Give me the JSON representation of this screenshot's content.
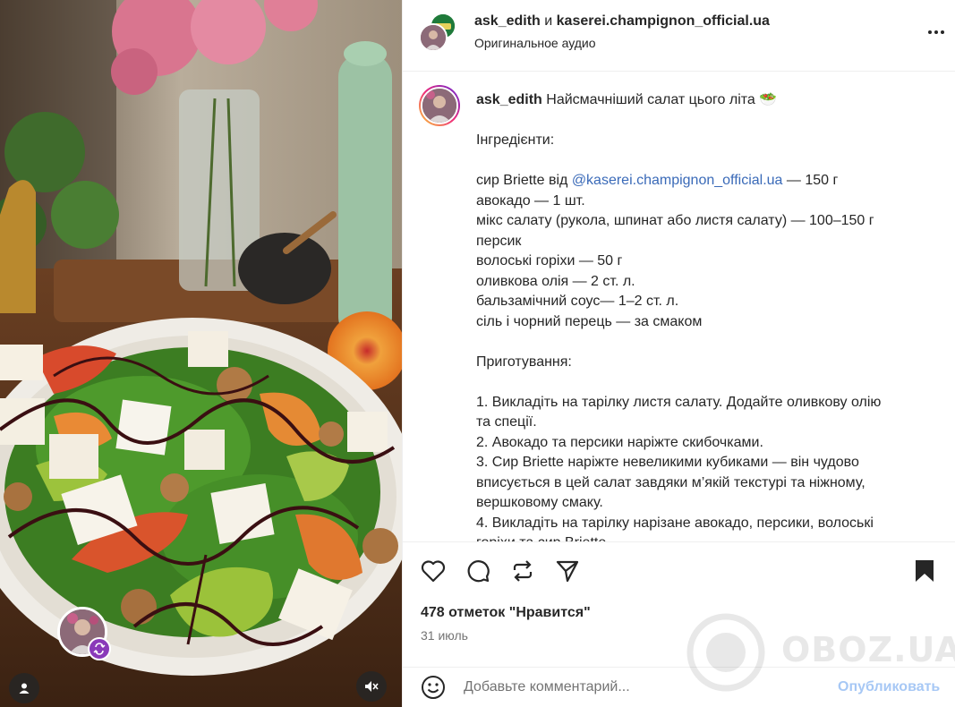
{
  "header": {
    "author": "ask_edith",
    "conjunction": "и",
    "collaborator": "kaserei.champignon_official.ua",
    "audio": "Оригинальное аудио"
  },
  "caption": {
    "username": "ask_edith",
    "title": "Найсмачніший салат цього літа 🥗",
    "lines": [
      "Інгредієнти:",
      "",
      "сир Briette від",
      "авокадо — 1 шт.",
      "мікс салату (рукола, шпинат або листя салату) — 100–150 г",
      "персик",
      "волоські горіхи — 50 г",
      "оливкова олія — 2 ст. л.",
      "бальзамічний соус— 1–2 ст. л.",
      "сіль і чорний перець — за смаком",
      "",
      "Приготування:",
      "",
      "1. Викладіть на тарілку листя салату. Додайте оливкову олію",
      "та спеції.",
      "2. Авокадо та персики наріжте скибочками.",
      "3. Сир Briette наріжте невеликими кубиками — він чудово",
      "вписується в цей салат завдяки м’якій текстурі та ніжному,",
      "вершковому смаку.",
      "4. Викладіть на тарілку нарізане авокадо, персики, волоські",
      "горіхи та сир Briette."
    ],
    "mention": "@kaserei.champignon_official.ua",
    "mention_suffix": " — 150 г"
  },
  "actions": {
    "like_icon": "heart-icon",
    "comment_icon": "comment-icon",
    "repost_icon": "repost-icon",
    "share_icon": "share-icon",
    "save_icon": "bookmark-icon"
  },
  "likes": "478 отметок \"Нравится\"",
  "date": "31 июль",
  "comment": {
    "placeholder": "Добавьте комментарий...",
    "publish": "Опубликовать"
  },
  "watermark": "OBOZ.UA",
  "colors": {
    "link": "#3a6ab8",
    "publish": "#a7c8f5",
    "muted": "#737373"
  }
}
